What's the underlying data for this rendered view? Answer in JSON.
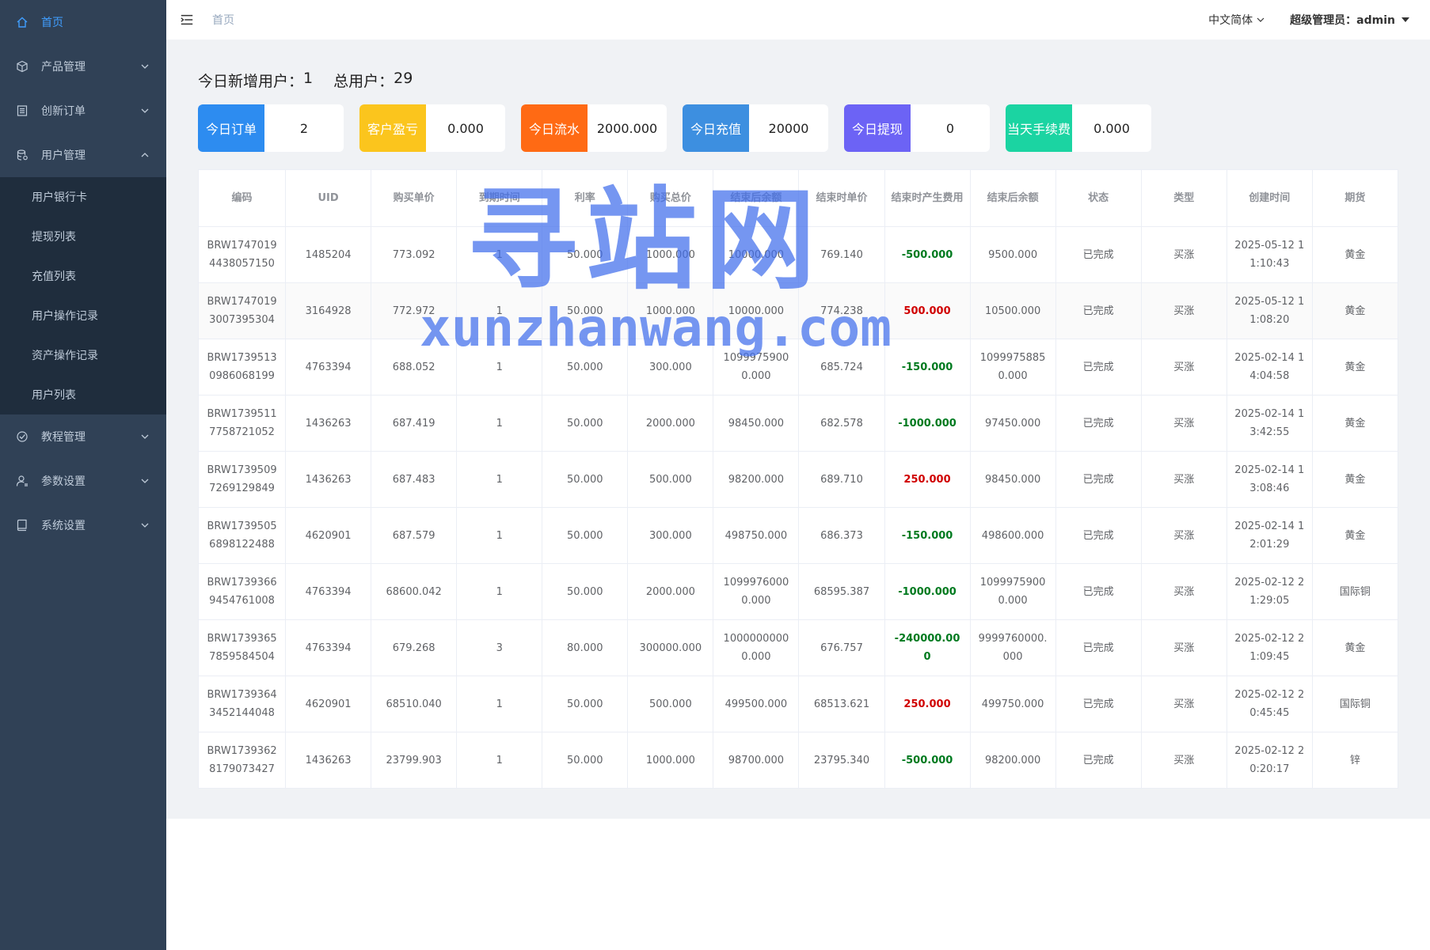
{
  "sidebar": {
    "home": "首页",
    "menus": [
      {
        "label": "产品管理",
        "icon": "cube-icon",
        "expanded": false
      },
      {
        "label": "创新订单",
        "icon": "order-icon",
        "expanded": false
      },
      {
        "label": "用户管理",
        "icon": "users-icon",
        "expanded": true
      }
    ],
    "user_submenu": [
      "用户银行卡",
      "提现列表",
      "充值列表",
      "用户操作记录",
      "资产操作记录",
      "用户列表"
    ],
    "menus_after": [
      {
        "label": "教程管理",
        "icon": "tutorial-icon"
      },
      {
        "label": "参数设置",
        "icon": "settings-user-icon"
      },
      {
        "label": "系统设置",
        "icon": "system-icon"
      }
    ]
  },
  "header": {
    "breadcrumb": "首页",
    "language": "中文简体",
    "user": "超级管理员：admin"
  },
  "summary": {
    "new_users_label": "今日新增用户：",
    "new_users_value": "1",
    "total_users_label": "总用户：",
    "total_users_value": "29"
  },
  "stats": [
    {
      "label": "今日订单",
      "value": "2",
      "color": "#2d8cf0"
    },
    {
      "label": "客户盈亏",
      "value": "0.000",
      "color": "#fbc51d"
    },
    {
      "label": "今日流水",
      "value": "2000.000",
      "color": "#ff6a14"
    },
    {
      "label": "今日充值",
      "value": "20000",
      "color": "#3d8fe0"
    },
    {
      "label": "今日提现",
      "value": "0",
      "color": "#6c63f5"
    },
    {
      "label": "当天手续费",
      "value": "0.000",
      "color": "#1bd4a2"
    }
  ],
  "table": {
    "headers": [
      "编码",
      "UID",
      "购买单价",
      "到期时间",
      "利率",
      "购买总价",
      "结束后余额",
      "结束时单价",
      "结束时产生费用",
      "结束后余额",
      "状态",
      "类型",
      "创建时间",
      "期货"
    ],
    "rows": [
      [
        "BRW17470194438057150",
        "1485204",
        "773.092",
        "1",
        "50.000",
        "1000.000",
        "10000.000",
        "769.140",
        "-500.000",
        "9500.000",
        "已完成",
        "买涨",
        "2025-05-12 11:10:43",
        "黄金"
      ],
      [
        "BRW17470193007395304",
        "3164928",
        "772.972",
        "1",
        "50.000",
        "1000.000",
        "10000.000",
        "774.238",
        "500.000",
        "10500.000",
        "已完成",
        "买涨",
        "2025-05-12 11:08:20",
        "黄金"
      ],
      [
        "BRW17395130986068199",
        "4763394",
        "688.052",
        "1",
        "50.000",
        "300.000",
        "10999759000.000",
        "685.724",
        "-150.000",
        "10999758850.000",
        "已完成",
        "买涨",
        "2025-02-14 14:04:58",
        "黄金"
      ],
      [
        "BRW17395117758721052",
        "1436263",
        "687.419",
        "1",
        "50.000",
        "2000.000",
        "98450.000",
        "682.578",
        "-1000.000",
        "97450.000",
        "已完成",
        "买涨",
        "2025-02-14 13:42:55",
        "黄金"
      ],
      [
        "BRW17395097269129849",
        "1436263",
        "687.483",
        "1",
        "50.000",
        "500.000",
        "98200.000",
        "689.710",
        "250.000",
        "98450.000",
        "已完成",
        "买涨",
        "2025-02-14 13:08:46",
        "黄金"
      ],
      [
        "BRW17395056898122488",
        "4620901",
        "687.579",
        "1",
        "50.000",
        "300.000",
        "498750.000",
        "686.373",
        "-150.000",
        "498600.000",
        "已完成",
        "买涨",
        "2025-02-14 12:01:29",
        "黄金"
      ],
      [
        "BRW17393669454761008",
        "4763394",
        "68600.042",
        "1",
        "50.000",
        "2000.000",
        "10999760000.000",
        "68595.387",
        "-1000.000",
        "10999759000.000",
        "已完成",
        "买涨",
        "2025-02-12 21:29:05",
        "国际铜"
      ],
      [
        "BRW17393657859584504",
        "4763394",
        "679.268",
        "3",
        "80.000",
        "300000.000",
        "10000000000.000",
        "676.757",
        "-240000.000",
        "9999760000.000",
        "已完成",
        "买涨",
        "2025-02-12 21:09:45",
        "黄金"
      ],
      [
        "BRW17393643452144048",
        "4620901",
        "68510.040",
        "1",
        "50.000",
        "500.000",
        "499500.000",
        "68513.621",
        "250.000",
        "499750.000",
        "已完成",
        "买涨",
        "2025-02-12 20:45:45",
        "国际铜"
      ],
      [
        "BRW17393628179073427",
        "1436263",
        "23799.903",
        "1",
        "50.000",
        "1000.000",
        "98700.000",
        "23795.340",
        "-500.000",
        "98200.000",
        "已完成",
        "买涨",
        "2025-02-12 20:20:17",
        "锌"
      ]
    ]
  },
  "watermark": {
    "line1": "寻站网",
    "line2": "xunzhanwang.com"
  },
  "colors": {
    "sidebar_bg": "#304156",
    "submenu_bg": "#1f2d3d",
    "accent": "#409eff",
    "profit": "#d00000",
    "loss": "#007a1f"
  }
}
